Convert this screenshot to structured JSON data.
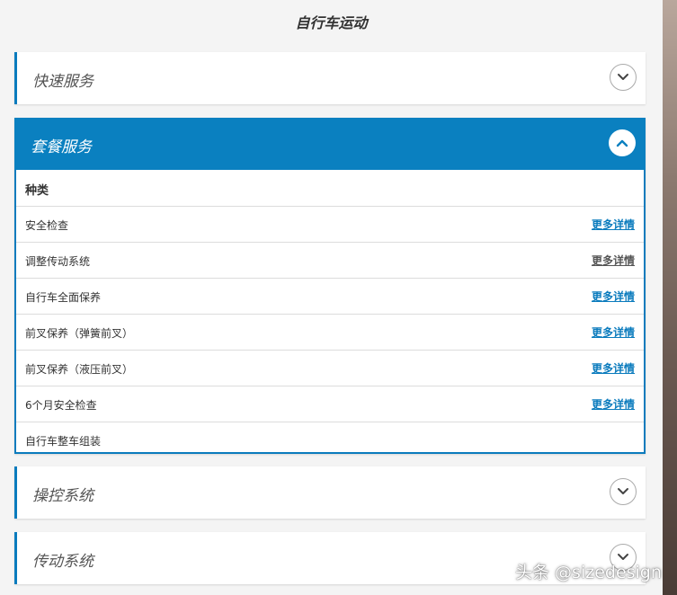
{
  "page": {
    "title": "自行车运动"
  },
  "accent_color": "#0a80c0",
  "panels": [
    {
      "title": "快速服务",
      "state": "collapsed"
    },
    {
      "title": "套餐服务",
      "state": "expanded"
    },
    {
      "title": "操控系统",
      "state": "collapsed"
    },
    {
      "title": "传动系统",
      "state": "collapsed"
    }
  ],
  "services": {
    "header": "种类",
    "items": [
      {
        "name": "安全检查",
        "link": "更多详情"
      },
      {
        "name": "调整传动系统",
        "link": "更多详情"
      },
      {
        "name": "自行车全面保养",
        "link": "更多详情"
      },
      {
        "name": "前叉保养（弹簧前叉）",
        "link": "更多详情"
      },
      {
        "name": "前叉保养（液压前叉）",
        "link": "更多详情"
      },
      {
        "name": "6个月安全检查",
        "link": "更多详情"
      },
      {
        "name": "自行车整车组装",
        "link": ""
      }
    ]
  },
  "icons": {
    "collapsed": "chevron-down-icon",
    "expanded": "chevron-up-icon"
  },
  "watermark": "头条 @sizedesign"
}
